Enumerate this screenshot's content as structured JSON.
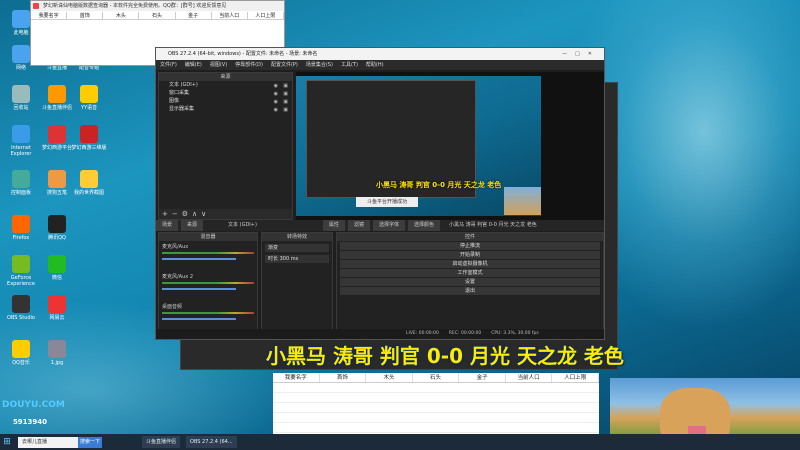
{
  "desktop": {
    "icons": [
      {
        "label": "此电脑",
        "color": "#4aa3ef"
      },
      {
        "label": "网络",
        "color": "#4aa3ef"
      },
      {
        "label": "斗鱼直播",
        "color": "#ff7a00"
      },
      {
        "label": "配音专题",
        "color": "#3b7"
      },
      {
        "label": "回收站",
        "color": "#9bb"
      },
      {
        "label": "斗鱼直播伴侣",
        "color": "#f90"
      },
      {
        "label": "YY语音",
        "color": "#fc0"
      },
      {
        "label": "Internet Explorer",
        "color": "#3a9be8"
      },
      {
        "label": "梦幻西游平台",
        "color": "#d33"
      },
      {
        "label": "梦幻西游三维版",
        "color": "#c22"
      },
      {
        "label": "控制面板",
        "color": "#4a9"
      },
      {
        "label": "搜狗五笔",
        "color": "#e94"
      },
      {
        "label": "我的世界截图",
        "color": "#fc3"
      },
      {
        "label": "Firefox",
        "color": "#f60"
      },
      {
        "label": "腾讯QQ",
        "color": "#222"
      },
      {
        "label": "GeForce Experience",
        "color": "#7b2"
      },
      {
        "label": "微信",
        "color": "#2b2"
      },
      {
        "label": "OBS Studio",
        "color": "#333"
      },
      {
        "label": "网易云",
        "color": "#e33"
      },
      {
        "label": "QQ音乐",
        "color": "#fc0"
      },
      {
        "label": "1.jpg",
        "color": "#889"
      }
    ]
  },
  "tinywin": {
    "title": "梦幻新诛仙电脑版数据查询器 - 本软件完全免费使用。QQ群：[群号] 欢迎反馈意见",
    "cols": [
      "我要名字",
      "首饰",
      "木头",
      "石头",
      "金子",
      "当前人口",
      "人口上限"
    ]
  },
  "obs": {
    "title": "OBS 27.2.4 (64-bit, windows) - 配置文件: 未命名 - 场景: 未命名",
    "menu": [
      "文件(F)",
      "编辑(E)",
      "视图(V)",
      "停靠部件(D)",
      "配置文件(P)",
      "场景集合(S)",
      "工具(T)",
      "帮助(H)"
    ],
    "sources_hdr": "来源",
    "sources": [
      "文本 (GDI+)",
      "窗口采集",
      "图像",
      "显示器采集"
    ],
    "tabs": [
      "场景",
      "来源"
    ],
    "selected": "文本 (GDI+)",
    "props_btn": "属性",
    "filters_btn": "滤镜",
    "fontbtn": "选择字体",
    "colorbtn": "选择颜色",
    "textval": "小黑马 涛哥 判官 0-0 月光 天之龙 老色",
    "preview_caption": "小黑马 涛哥 判官 0-0 月光 天之龙 老色",
    "preview_popup": "斗鱼平台开播成功",
    "mixer_hdr": "混音器",
    "channels": [
      "麦克风/Aux",
      "麦克风/Aux 2",
      "桌面音频"
    ],
    "trans_hdr": "转场特效",
    "trans_rows": [
      "渐变",
      "时长  300 ms"
    ],
    "controls_hdr": "控件",
    "controls": [
      "停止推流",
      "开始录制",
      "启动虚拟摄像机",
      "工作室模式",
      "设置",
      "退出"
    ],
    "status": [
      "LIVE: 00:00:00",
      "REC: 00:00:00",
      "CPU: 3.3%, 30.00 fps"
    ]
  },
  "caption": "小黑马 涛哥 判官 0-0 月光 天之龙 老色",
  "table_cols": [
    "我要名字",
    "首饰",
    "木头",
    "石头",
    "金子",
    "当前人口",
    "人口上限"
  ],
  "douyu": {
    "logo": "DOUYU.COM",
    "id": "5913940"
  },
  "taskbar": {
    "search": "去哪儿直播",
    "search_btn": "搜索一下",
    "tasks": [
      "斗鱼直播伴侣",
      "OBS 27.2.4 (64..."
    ]
  }
}
